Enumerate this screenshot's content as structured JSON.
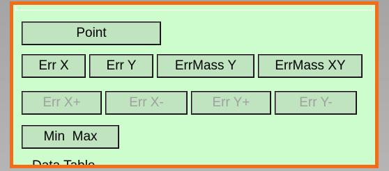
{
  "panel": {
    "border_color": "#f36c16",
    "background_color": "#cdfccd",
    "buttons": {
      "point": "Point",
      "err_x": "Err X",
      "err_y": "Err Y",
      "errmass_y": "ErrMass Y",
      "errmass_xy": "ErrMass XY",
      "err_x_plus": "Err X+",
      "err_x_minus": "Err X-",
      "err_y_plus": "Err Y+",
      "err_y_minus": "Err Y-",
      "min_max": "Min  Max"
    },
    "footer_label": "Data Table"
  }
}
